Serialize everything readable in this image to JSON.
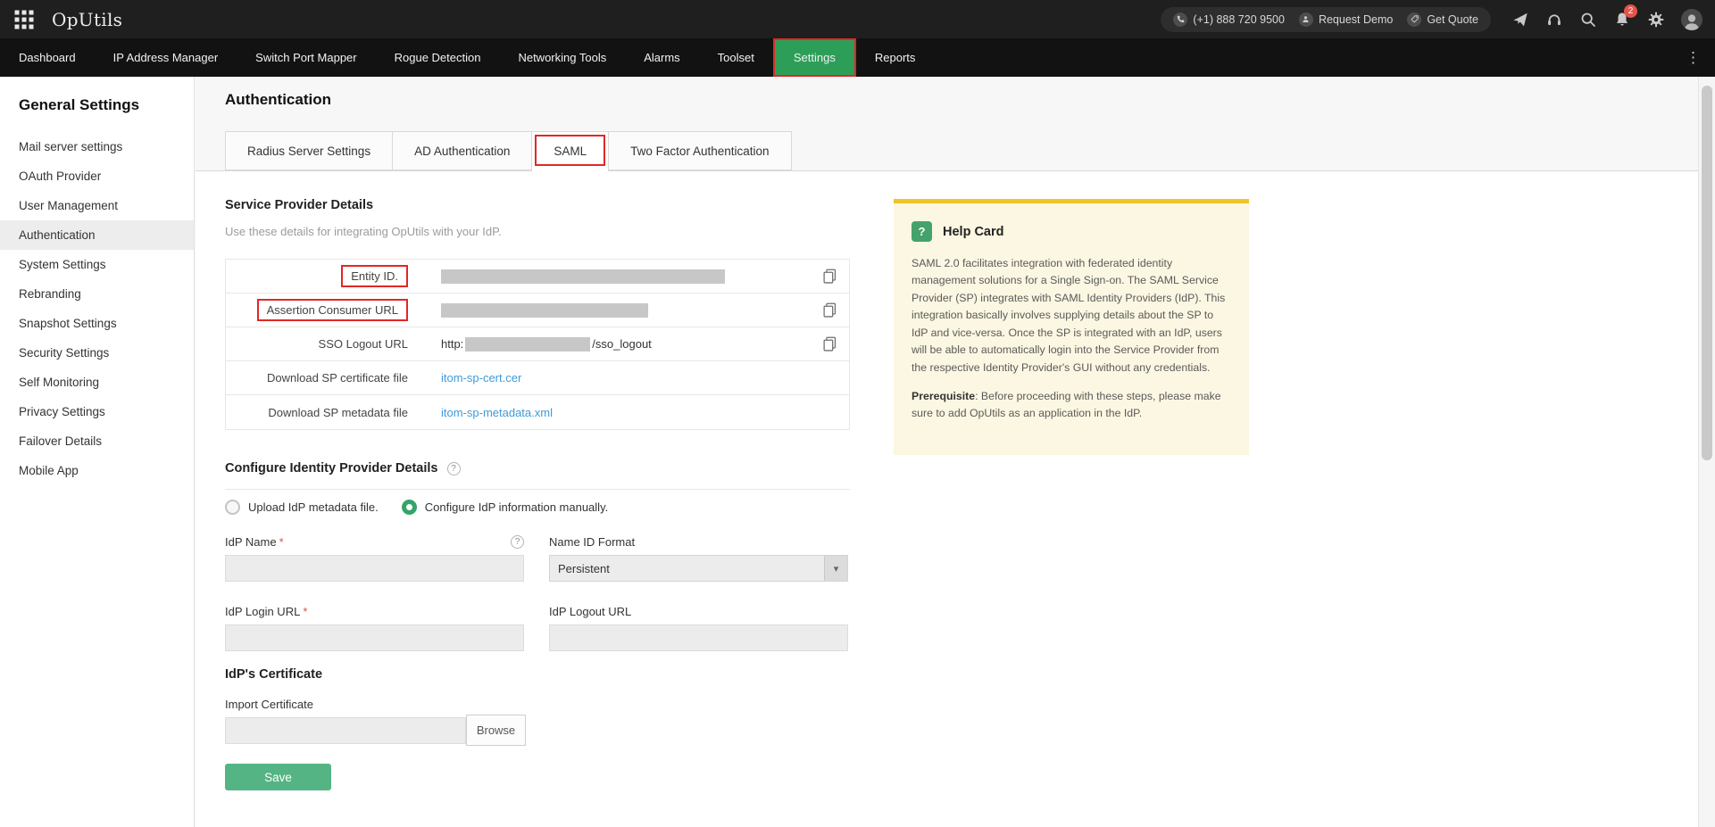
{
  "header": {
    "logo": "OpUtils",
    "phone": "(+1) 888 720 9500",
    "request_demo": "Request Demo",
    "get_quote": "Get Quote",
    "notifications_badge": "2"
  },
  "nav": {
    "items": [
      "Dashboard",
      "IP Address Manager",
      "Switch Port Mapper",
      "Rogue Detection",
      "Networking Tools",
      "Alarms",
      "Toolset",
      "Settings",
      "Reports"
    ],
    "active": "Settings"
  },
  "sidebar": {
    "title": "General Settings",
    "items": [
      "Mail server settings",
      "OAuth Provider",
      "User Management",
      "Authentication",
      "System Settings",
      "Rebranding",
      "Snapshot Settings",
      "Security Settings",
      "Self Monitoring",
      "Privacy Settings",
      "Failover Details",
      "Mobile App"
    ],
    "active": "Authentication"
  },
  "main": {
    "page_title": "Authentication",
    "tabs": [
      "Radius Server Settings",
      "AD Authentication",
      "SAML",
      "Two Factor Authentication"
    ],
    "active_tab": "SAML",
    "sp": {
      "heading": "Service Provider Details",
      "description": "Use these details for integrating OpUtils with your IdP.",
      "entity_label": "Entity ID.",
      "acs_label": "Assertion Consumer URL",
      "sso_label": "SSO Logout URL",
      "sso_prefix": "http:",
      "sso_suffix": "/sso_logout",
      "cert_label": "Download SP certificate file",
      "cert_link": "itom-sp-cert.cer",
      "meta_label": "Download SP metadata file",
      "meta_link": "itom-sp-metadata.xml"
    },
    "idp": {
      "heading": "Configure Identity Provider Details",
      "radio_upload": "Upload IdP metadata file.",
      "radio_manual": "Configure IdP information manually.",
      "idp_name_label": "IdP Name",
      "idp_name_value": "",
      "name_id_format_label": "Name ID Format",
      "name_id_format_value": "Persistent",
      "idp_login_label": "IdP Login URL",
      "idp_login_value": "",
      "idp_logout_label": "IdP Logout URL",
      "idp_logout_value": "",
      "required_marker": "*",
      "cert_heading": "IdP's Certificate",
      "import_label": "Import Certificate",
      "import_value": "",
      "browse_label": "Browse",
      "save_label": "Save"
    }
  },
  "help_card": {
    "title": "Help Card",
    "body": "SAML 2.0 facilitates integration with federated identity management solutions for a Single Sign-on. The SAML Service Provider (SP) integrates with SAML Identity Providers (IdP). This integration basically involves supplying details about the SP to IdP and vice-versa. Once the SP is integrated with an IdP, users will be able to automatically login into the Service Provider from the respective Identity Provider's GUI without any credentials.",
    "prerequisite_label": "Prerequisite",
    "prerequisite_text": ": Before proceeding with these steps, please make sure to add OpUtils as an application in the IdP."
  },
  "icons": {
    "help": "?",
    "more": "⋮",
    "dropdown": "▾"
  },
  "colors": {
    "accent_green": "#2d9e58",
    "annotation_red": "#e12726",
    "link_blue": "#3f9bd8",
    "help_card_bg": "#fcf7e2",
    "help_card_border": "#efc32a",
    "save_green": "#54b483"
  }
}
